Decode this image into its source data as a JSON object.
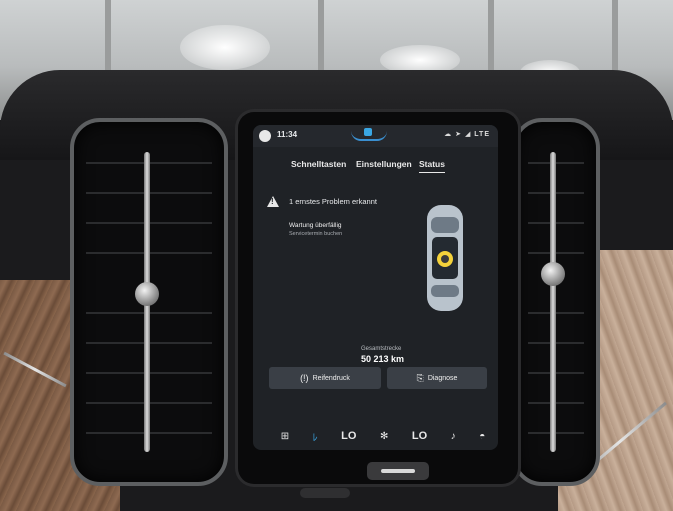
{
  "status_bar": {
    "time": "11:34",
    "network": "LTE"
  },
  "tabs": [
    {
      "label": "Schnelltasten",
      "active": false
    },
    {
      "label": "Einstellungen",
      "active": false
    },
    {
      "label": "Status",
      "active": true
    }
  ],
  "status": {
    "alert": "1 ernstes Problem erkannt",
    "maintenance_title": "Wartung überfällig",
    "maintenance_subtitle": "Servicetermin buchen",
    "mileage_label": "Gesamtstrecke",
    "mileage_value": "50 213 km"
  },
  "actions": {
    "tire_pressure": "Reifendruck",
    "diagnosis": "Diagnose"
  },
  "climate_bar": {
    "left_temp": "LO",
    "right_temp": "LO",
    "icons": [
      "apps-grid-icon",
      "seat-heat-icon",
      "fan-icon",
      "seat-icon",
      "defrost-icon"
    ]
  },
  "colors": {
    "screen_bg": "#1f2226",
    "button_bg": "#3a3f46",
    "accent": "#3aa7e4",
    "car_body": "#b9c3cc",
    "warning_dot": "#f4d23b"
  }
}
